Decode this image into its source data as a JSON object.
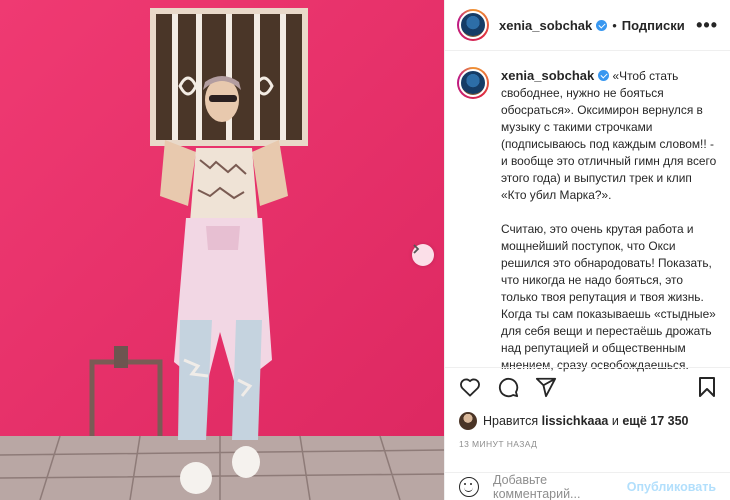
{
  "post": {
    "username": "xenia_sobchak",
    "header_separator": "•",
    "follow_label": "Подписки",
    "more_label": "•••",
    "caption_paragraphs": [
      "«Чтоб стать свободнее, нужно не бояться обосраться». Оксимирон вернулся в музыку с такими строчками (подписываюсь под каждым словом!! - и вообще это отличный гимн для всего этого года) и выпустил трек и клип «Кто убил Марка?».",
      "Считаю, это очень крутая работа и мощнейший поступок, что Окси решился это обнародовать! Показать, что никогда не надо бояться, это только твоя репутация и твоя жизнь. Когда ты сам показываешь «стыдные» для себя вещи и перестаёшь дрожать над репутацией и общественным мнением, сразу освобождаешься."
    ],
    "likes": {
      "prefix": "Нравится",
      "user": "lissichkaaa",
      "connector": "и",
      "count_text": "ещё 17 350"
    },
    "timestamp": "13 МИНУТ НАЗАД",
    "comment_placeholder": "Добавьте комментарий...",
    "publish_label": "Опубликовать"
  },
  "icons": {
    "like": "heart-icon",
    "comment": "comment-icon",
    "share": "paper-plane-icon",
    "save": "bookmark-icon",
    "next": "chevron-right-icon",
    "emoji": "smiley-icon",
    "verified": "verified-badge-icon"
  },
  "colors": {
    "wall": "#ea2f6a",
    "verified": "#3897f0",
    "publish_disabled": "#b2dffc",
    "muted_text": "#8e8e8e"
  }
}
